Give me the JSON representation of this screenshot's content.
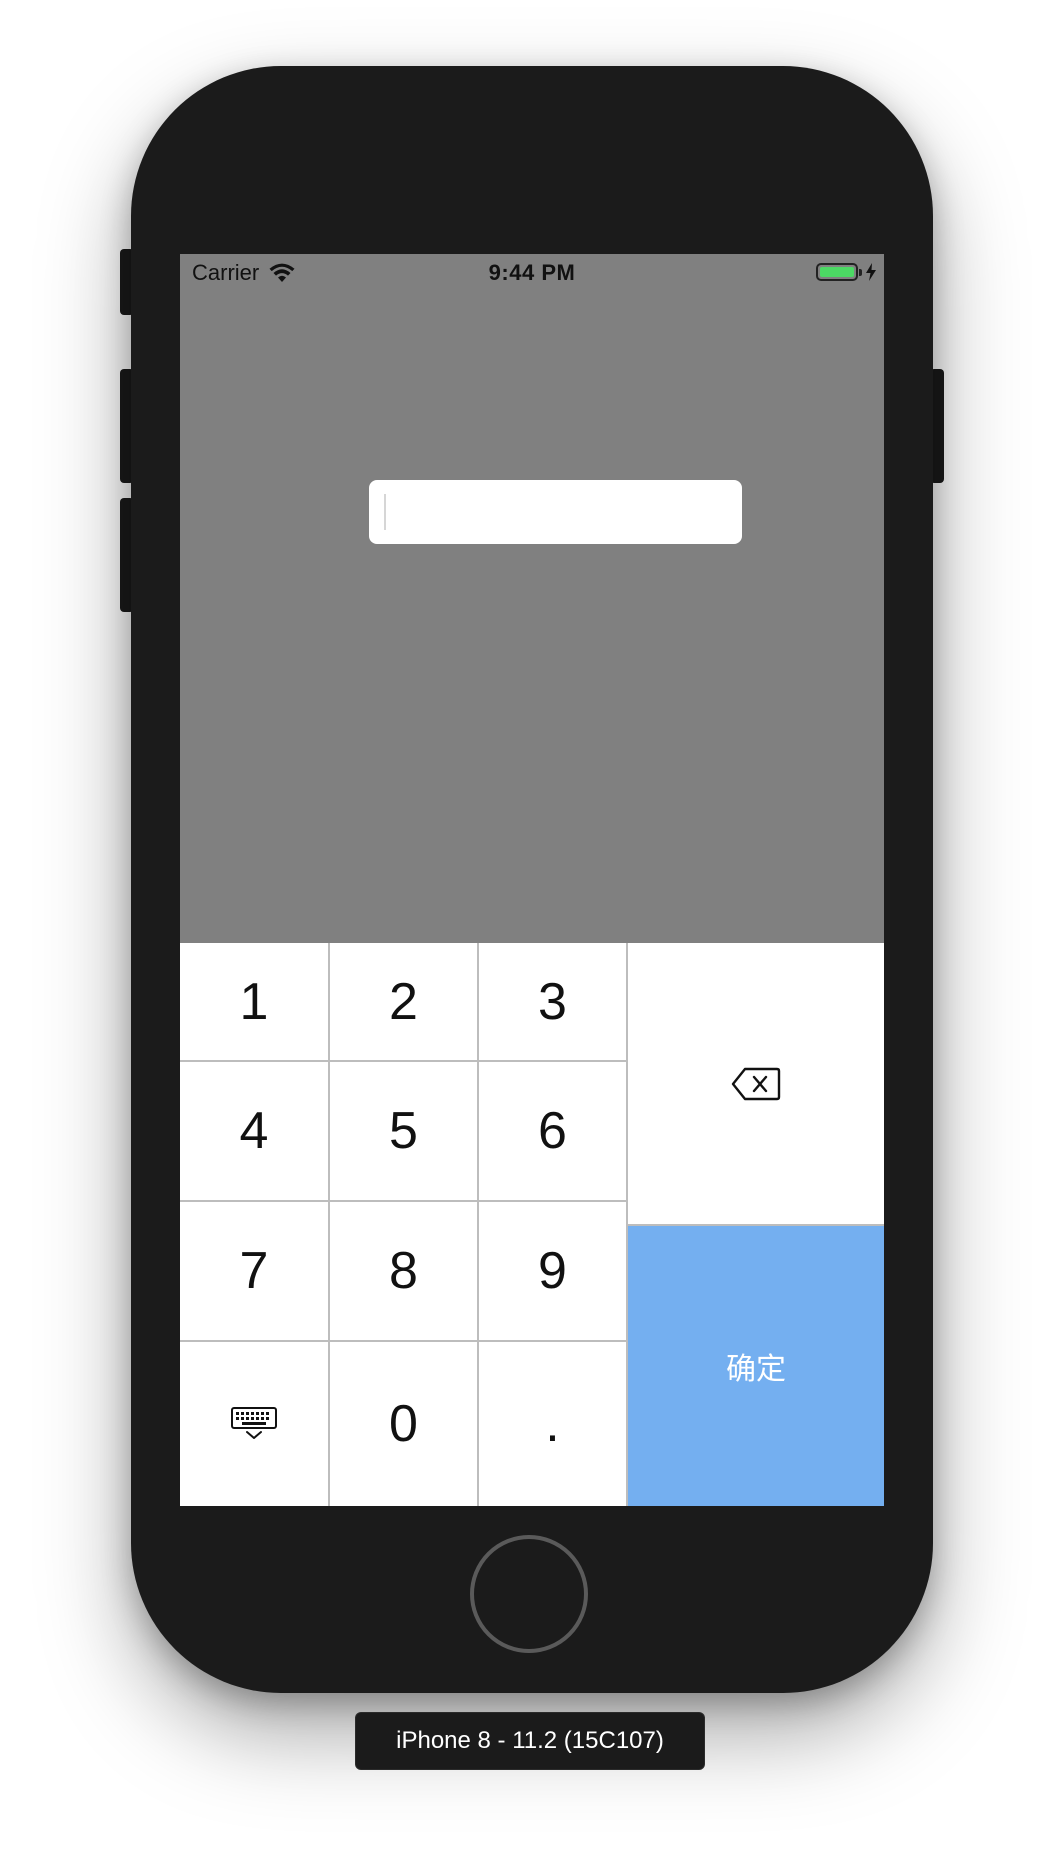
{
  "status_bar": {
    "carrier": "Carrier",
    "time": "9:44 PM",
    "battery_color": "#4cd964"
  },
  "input": {
    "value": "",
    "placeholder": ""
  },
  "keypad": {
    "keys": {
      "k1": "1",
      "k2": "2",
      "k3": "3",
      "k4": "4",
      "k5": "5",
      "k6": "6",
      "k7": "7",
      "k8": "8",
      "k9": "9",
      "k0": "0",
      "dot": "."
    },
    "confirm_label": "确定",
    "delete_icon": "backspace-icon",
    "hide_icon": "keyboard-hide-icon",
    "confirm_color": "#74aff0"
  },
  "device": {
    "label": "iPhone 8 - 11.2 (15C107)"
  },
  "colors": {
    "screen_background": "#808080",
    "phone_body": "#1b1b1b"
  }
}
